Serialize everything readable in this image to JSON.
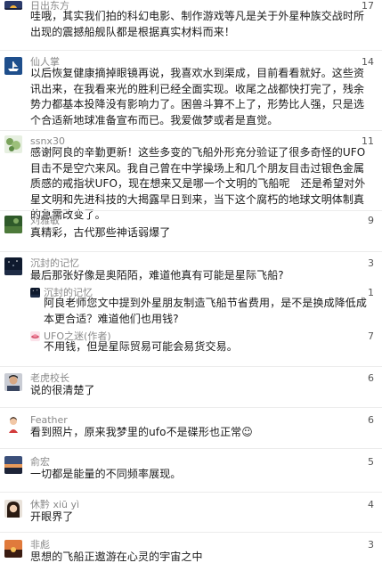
{
  "comments": [
    {
      "author": "日出东方",
      "likes": "17",
      "text": "哇哦，其实我们拍的科幻电影、制作游戏等凡是关于外星种族交战时所出现的震撼船舰队都是根据真实材料而来！",
      "avatar": "avatar-sunrise"
    },
    {
      "author": "仙人掌",
      "likes": "14",
      "text": "以后恢复健康摘掉眼镜再说，我喜欢水到渠成，目前看看就好。这些资讯出来，在我看来光的胜利已经全面实现。收尾之战都快打完了，残余势力都基本投降没有影响力了。困兽斗算不上了，形势比人强，只是选个合适新地球准备宣布而已。我爱做梦或者是直觉。",
      "avatar": "avatar-ship"
    },
    {
      "author": "ssnx30",
      "likes": "11",
      "text": "感谢阿良的辛勤更新！这些多变的飞船外形充分验证了很多奇怪的UFO目击不是空穴来风。我自己曾在中学操场上和几个朋友目击过银色金属质感的戒指状UFO，现在想来又是哪一个文明的飞船呢　还是希望对外星文明和先进科技的大揭露早日到来，当下这个腐朽的地球文明体制真的急需改变了。",
      "avatar": "avatar-leaves"
    },
    {
      "author": "刘雅敏",
      "likes": "9",
      "text": "真精彩，古代那些神话弱爆了",
      "avatar": "avatar-green"
    },
    {
      "author": "沉封的记忆",
      "likes": "3",
      "text": "最后那张好像是奥陌陌，难道他真有可能是星际飞船?",
      "avatar": "avatar-night"
    },
    {
      "author": "沉封的记忆",
      "likes": "1",
      "text": "阿良老师您文中提到外星朋友制造飞船节省费用，是不是换成降低成本更合适？难道他们也用钱?",
      "avatar": "avatar-night",
      "reply": true
    },
    {
      "author": "UFO之迷(作者)",
      "likes": "7",
      "text": "不用钱，但是星际贸易可能会易货交易。",
      "avatar": "avatar-author",
      "reply": true
    },
    {
      "author": "老虎校长",
      "likes": "6",
      "text": "说的很清楚了",
      "avatar": "avatar-man"
    },
    {
      "author": "Feather",
      "likes": "6",
      "text": "看到照片，原来我梦里的ufo不是碟形也正常☺",
      "avatar": "avatar-feather"
    },
    {
      "author": "俞宏",
      "likes": "5",
      "text": "一切都是能量的不同频率展现。",
      "avatar": "avatar-sunset"
    },
    {
      "author": "休黔 xiū yì",
      "likes": "4",
      "text": "开眼界了",
      "avatar": "avatar-girl"
    },
    {
      "author": "非彪",
      "likes": "3",
      "text": "思想的飞船正遨游在心灵的宇宙之中",
      "avatar": "avatar-dusk"
    }
  ]
}
